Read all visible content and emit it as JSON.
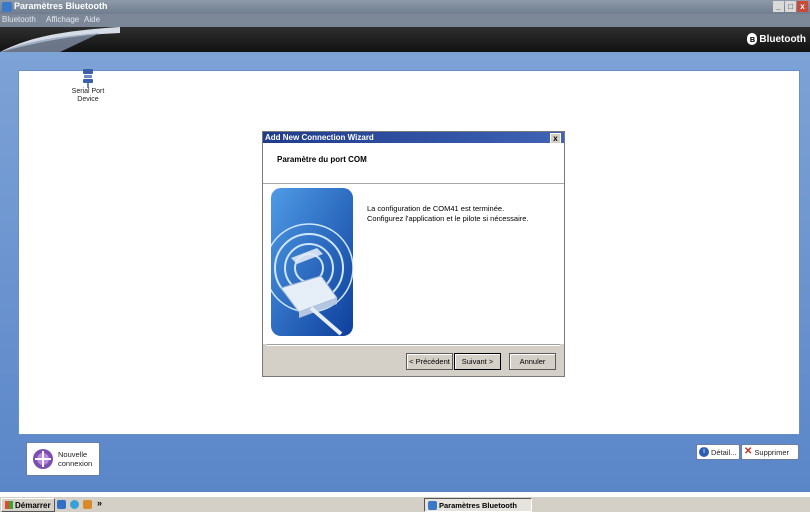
{
  "window": {
    "title": "Paramètres Bluetooth",
    "controls": [
      "_",
      "□",
      "x"
    ]
  },
  "menu": [
    "Bluetooth",
    "Affichage",
    "Aide"
  ],
  "header": {
    "brand": "Bluetooth"
  },
  "devices": [
    {
      "label_line1": "Serial Port",
      "label_line2": "Device"
    }
  ],
  "dialog": {
    "title": "Add New Connection Wizard",
    "close": "x",
    "heading": "Paramètre du port COM",
    "message_line1": "La configuration de COM41 est terminée.",
    "message_line2": "Configurez l'application et le pilote si nécessaire.",
    "buttons": {
      "back": "< Précédent",
      "next": "Suivant >",
      "cancel": "Annuler"
    }
  },
  "bottom": {
    "new_connection_line1": "Nouvelle",
    "new_connection_line2": "connexion",
    "detail": "Détail...",
    "delete": "Supprimer"
  },
  "taskbar": {
    "start": "Démarrer",
    "overflow": "»",
    "task": "Paramètres Bluetooth"
  },
  "colors": {
    "frame_blue": "#5a86c8",
    "dialog_title": "#1f3c8c",
    "header_dark": "#121212"
  }
}
